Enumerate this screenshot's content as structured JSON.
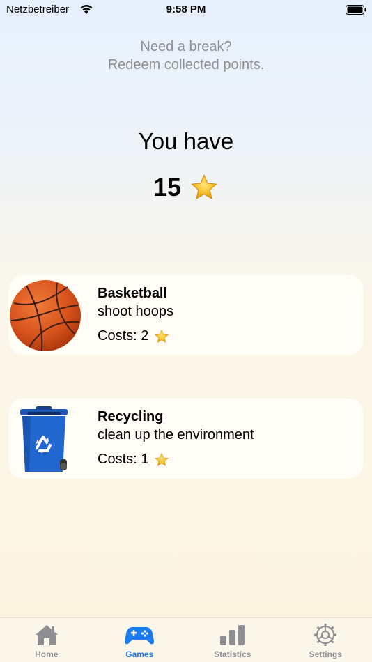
{
  "status_bar": {
    "carrier": "Netzbetreiber",
    "time": "9:58 PM"
  },
  "header": {
    "subtitle_line1": "Need a break?",
    "subtitle_line2": "Redeem collected points."
  },
  "points": {
    "label": "You have",
    "value": "15",
    "icon": "star-icon"
  },
  "games": [
    {
      "title": "Basketball",
      "description": "shoot hoops",
      "cost_label": "Costs: 2",
      "image": "basketball-icon"
    },
    {
      "title": "Recycling",
      "description": "clean up the environment",
      "cost_label": "Costs: 1",
      "image": "recycling-bin-icon"
    }
  ],
  "tab_bar": {
    "items": [
      {
        "label": "Home",
        "icon": "house-icon",
        "active": false
      },
      {
        "label": "Games",
        "icon": "gamecontroller-icon",
        "active": true
      },
      {
        "label": "Statistics",
        "icon": "chart-bar-icon",
        "active": false
      },
      {
        "label": "Settings",
        "icon": "gear-icon",
        "active": false
      }
    ]
  },
  "colors": {
    "accent": "#1a7cf0",
    "inactive": "#8e8e93",
    "card_background": "#fffdf5"
  }
}
